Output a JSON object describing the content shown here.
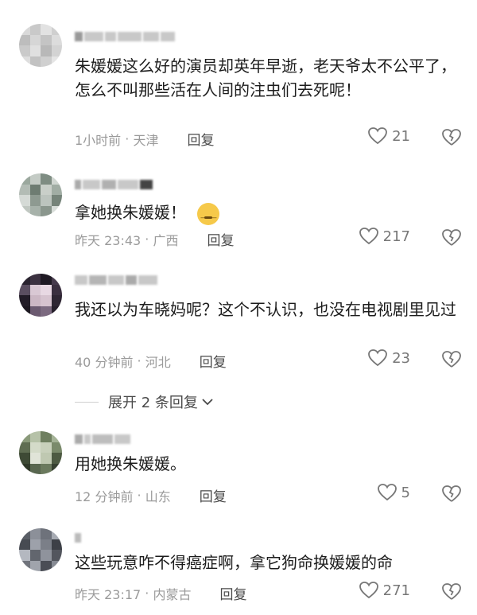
{
  "comments": [
    {
      "text": "朱媛媛这么好的演员却英年早逝，老天爷太不公平了，怎么不叫那些活在人间的注虫们去死呢！",
      "time": "1小时前",
      "location": "天津",
      "reply": "回复",
      "likes": "21"
    },
    {
      "text": "拿她换朱媛媛！",
      "emoji": "smirk-emoji",
      "time": "昨天 23:43",
      "location": "广西",
      "reply": "回复",
      "likes": "217"
    },
    {
      "text": "我还以为车晓妈呢？这个不认识，也没在电视剧里见过",
      "time": "40 分钟前",
      "location": "河北",
      "reply": "回复",
      "likes": "23"
    },
    {
      "text": "用她换朱媛媛。",
      "time": "12 分钟前",
      "location": "山东",
      "reply": "回复",
      "likes": "5"
    },
    {
      "text": "这些玩意咋不得癌症啊，拿它狗命换媛媛的命",
      "time": "昨天 23:17",
      "location": "内蒙古",
      "reply": "回复",
      "likes": "271"
    }
  ],
  "expand_replies": "展开 2 条回复",
  "icons": {
    "like": "heart-outline-icon",
    "dislike": "broken-heart-icon",
    "expand": "chevron-down-icon"
  },
  "colors": {
    "meta": "#9a9a9a",
    "text": "#1c1c1c",
    "accent_reply": "#4a4a4a"
  }
}
